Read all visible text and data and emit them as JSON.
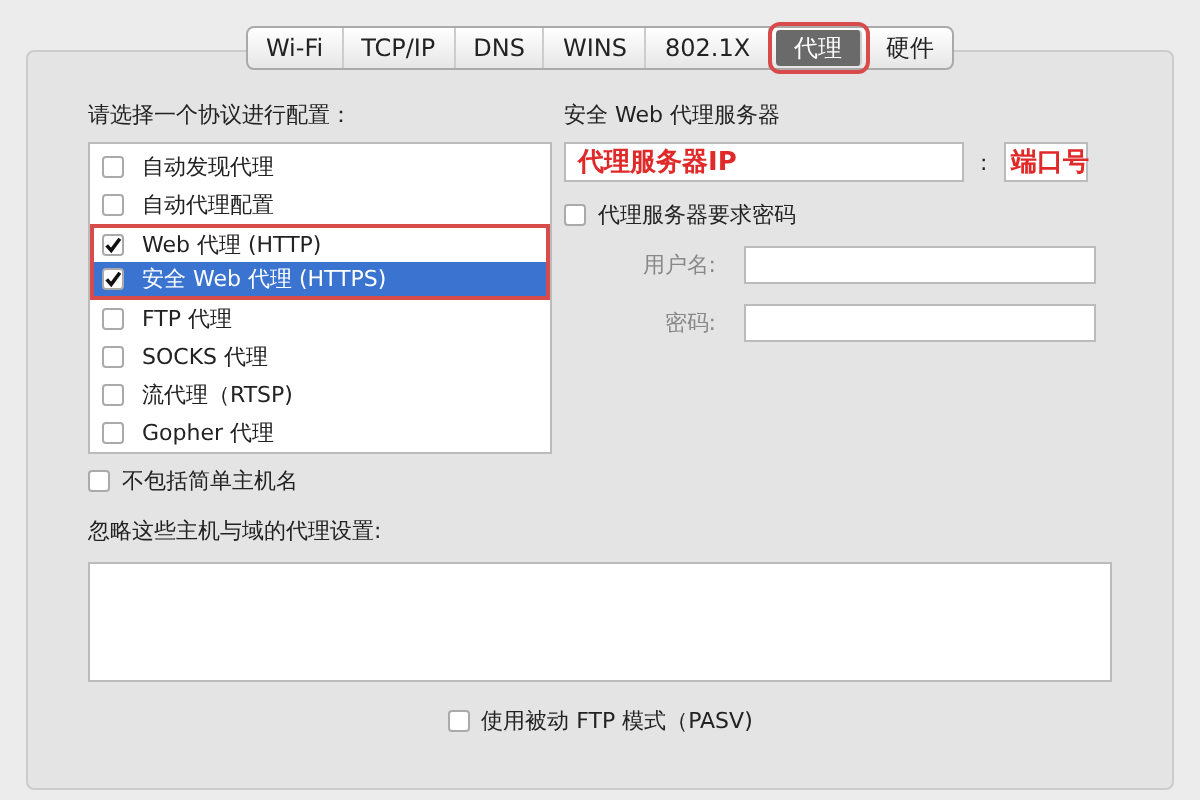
{
  "tabs": [
    {
      "label": "Wi-Fi",
      "selected": false,
      "highlighted": false
    },
    {
      "label": "TCP/IP",
      "selected": false,
      "highlighted": false
    },
    {
      "label": "DNS",
      "selected": false,
      "highlighted": false
    },
    {
      "label": "WINS",
      "selected": false,
      "highlighted": false
    },
    {
      "label": "802.1X",
      "selected": false,
      "highlighted": false
    },
    {
      "label": "代理",
      "selected": true,
      "highlighted": true
    },
    {
      "label": "硬件",
      "selected": false,
      "highlighted": false
    }
  ],
  "protocols": {
    "heading": "请选择一个协议进行配置：",
    "items": [
      {
        "label": "自动发现代理",
        "checked": false,
        "selected": false,
        "highlighted": false
      },
      {
        "label": "自动代理配置",
        "checked": false,
        "selected": false,
        "highlighted": false
      },
      {
        "label": "Web 代理 (HTTP)",
        "checked": true,
        "selected": false,
        "highlighted": true
      },
      {
        "label": "安全 Web 代理 (HTTPS)",
        "checked": true,
        "selected": true,
        "highlighted": true
      },
      {
        "label": "FTP 代理",
        "checked": false,
        "selected": false,
        "highlighted": false
      },
      {
        "label": "SOCKS 代理",
        "checked": false,
        "selected": false,
        "highlighted": false
      },
      {
        "label": "流代理（RTSP)",
        "checked": false,
        "selected": false,
        "highlighted": false
      },
      {
        "label": "Gopher 代理",
        "checked": false,
        "selected": false,
        "highlighted": false
      }
    ]
  },
  "server": {
    "heading": "安全 Web 代理服务器",
    "host": {
      "value": "代理服务器IP"
    },
    "separator": ":",
    "port": {
      "value": "端口号"
    },
    "requires_password": {
      "label": "代理服务器要求密码",
      "checked": false
    },
    "username": {
      "label": "用户名:"
    },
    "password": {
      "label": "密码:"
    }
  },
  "exclude_simple_hostnames": {
    "label": "不包括简单主机名",
    "checked": false
  },
  "bypass": {
    "label": "忽略这些主机与域的代理设置:"
  },
  "passive_ftp": {
    "label": "使用被动 FTP 模式（PASV)",
    "checked": false
  }
}
